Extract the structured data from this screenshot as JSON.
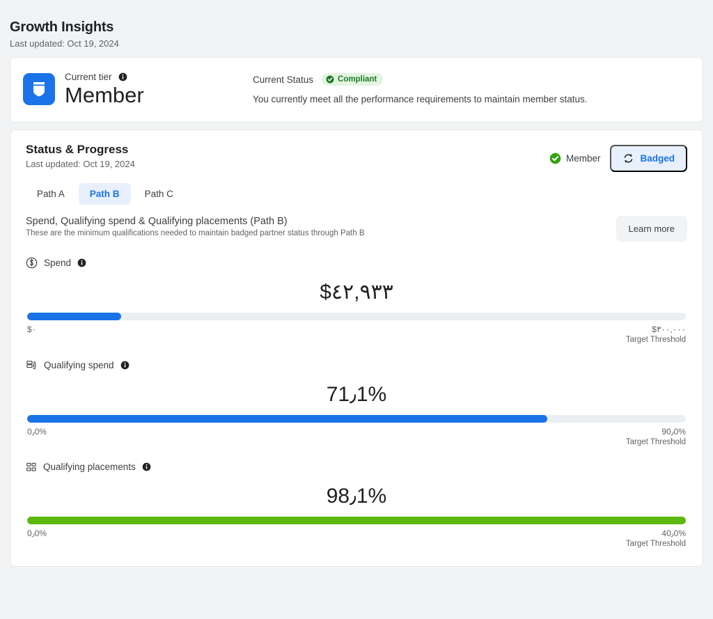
{
  "header": {
    "title": "Growth Insights",
    "last_updated": "Last updated: Oct 19, 2024"
  },
  "tier_card": {
    "tier_label": "Current tier",
    "tier_value": "Member",
    "tier_icon": "shield-badge-icon",
    "status_label": "Current Status",
    "status_badge": "Compliant",
    "status_badge_icon": "check-circle-icon",
    "status_description": "You currently meet all the performance requirements to maintain member status.",
    "colors": {
      "tier_icon_bg": "#1a73e8",
      "badge_bg": "#e3f4e0",
      "badge_text": "#1e7a29"
    }
  },
  "progress_card": {
    "title": "Status & Progress",
    "last_updated": "Last updated: Oct 19, 2024",
    "member_chip": {
      "icon": "check-circle-icon",
      "label": "Member"
    },
    "badged_pill": {
      "icon": "sync-refresh-icon",
      "label": "Badged"
    },
    "tabs": [
      {
        "label": "Path A",
        "active": false
      },
      {
        "label": "Path B",
        "active": true
      },
      {
        "label": "Path C",
        "active": false
      }
    ],
    "requirements": {
      "title": "Spend, Qualifying spend & Qualifying placements (Path B)",
      "subtitle": "These are the minimum qualifications needed to maintain badged partner status through Path B",
      "learn_more_label": "Learn more"
    },
    "metrics": [
      {
        "icon": "dollar-circle-icon",
        "name": "Spend",
        "info_icon": "info-icon",
        "value": "$٤٢,٩٣٣",
        "min_label": "$٠",
        "max_label": "$٣٠٠,٠٠٠",
        "caption": "Target Threshold",
        "fill_percent": 14.3,
        "color": "#1a73e8"
      },
      {
        "icon": "stacked-bills-icon",
        "name": "Qualifying spend",
        "info_icon": "info-icon",
        "value": "71٫1%",
        "min_label": "0٫0%",
        "max_label": "90٫0%",
        "caption": "Target Threshold",
        "fill_percent": 79.0,
        "color": "#1a73e8"
      },
      {
        "icon": "grid-squares-icon",
        "name": "Qualifying placements",
        "info_icon": "info-icon",
        "value": "98٫1%",
        "min_label": "0٫0%",
        "max_label": "40٫0%",
        "caption": "Target Threshold",
        "fill_percent": 100,
        "color": "#5cb80c"
      }
    ]
  }
}
